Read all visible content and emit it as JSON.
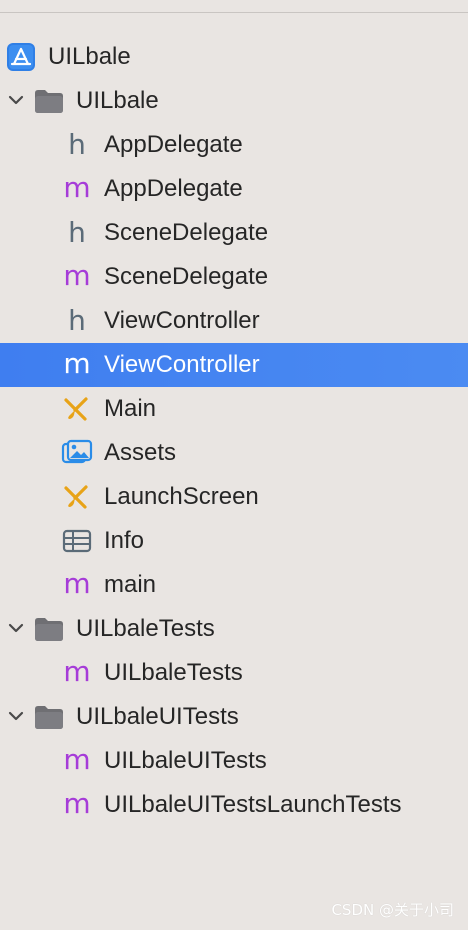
{
  "navigator": {
    "project": {
      "label": "UILbale",
      "icon": "xcode-project-icon"
    },
    "items": [
      {
        "label": "UILbale",
        "icon": "folder-icon",
        "type": "group"
      },
      {
        "label": "AppDelegate",
        "icon": "header-file-icon",
        "glyph": "h"
      },
      {
        "label": "AppDelegate",
        "icon": "objc-file-icon",
        "glyph": "m"
      },
      {
        "label": "SceneDelegate",
        "icon": "header-file-icon",
        "glyph": "h"
      },
      {
        "label": "SceneDelegate",
        "icon": "objc-file-icon",
        "glyph": "m"
      },
      {
        "label": "ViewController",
        "icon": "header-file-icon",
        "glyph": "h"
      },
      {
        "label": "ViewController",
        "icon": "objc-file-icon",
        "glyph": "m",
        "selected": true
      },
      {
        "label": "Main",
        "icon": "storyboard-icon"
      },
      {
        "label": "Assets",
        "icon": "asset-catalog-icon"
      },
      {
        "label": "LaunchScreen",
        "icon": "storyboard-icon"
      },
      {
        "label": "Info",
        "icon": "plist-icon"
      },
      {
        "label": "main",
        "icon": "objc-file-icon",
        "glyph": "m"
      },
      {
        "label": "UILbaleTests",
        "icon": "folder-icon",
        "type": "group"
      },
      {
        "label": "UILbaleTests",
        "icon": "objc-file-icon",
        "glyph": "m"
      },
      {
        "label": "UILbaleUITests",
        "icon": "folder-icon",
        "type": "group"
      },
      {
        "label": "UILbaleUITests",
        "icon": "objc-file-icon",
        "glyph": "m"
      },
      {
        "label": "UILbaleUITestsLaunchTests",
        "icon": "objc-file-icon",
        "glyph": "m"
      }
    ]
  },
  "colors": {
    "background": "#e9e5e2",
    "selection": "#4285f0",
    "objc_glyph": "#a63cd8",
    "header_glyph": "#5b6b78",
    "storyboard": "#e8a317",
    "assets": "#2a8ce8"
  },
  "watermark": "CSDN @关于小司"
}
